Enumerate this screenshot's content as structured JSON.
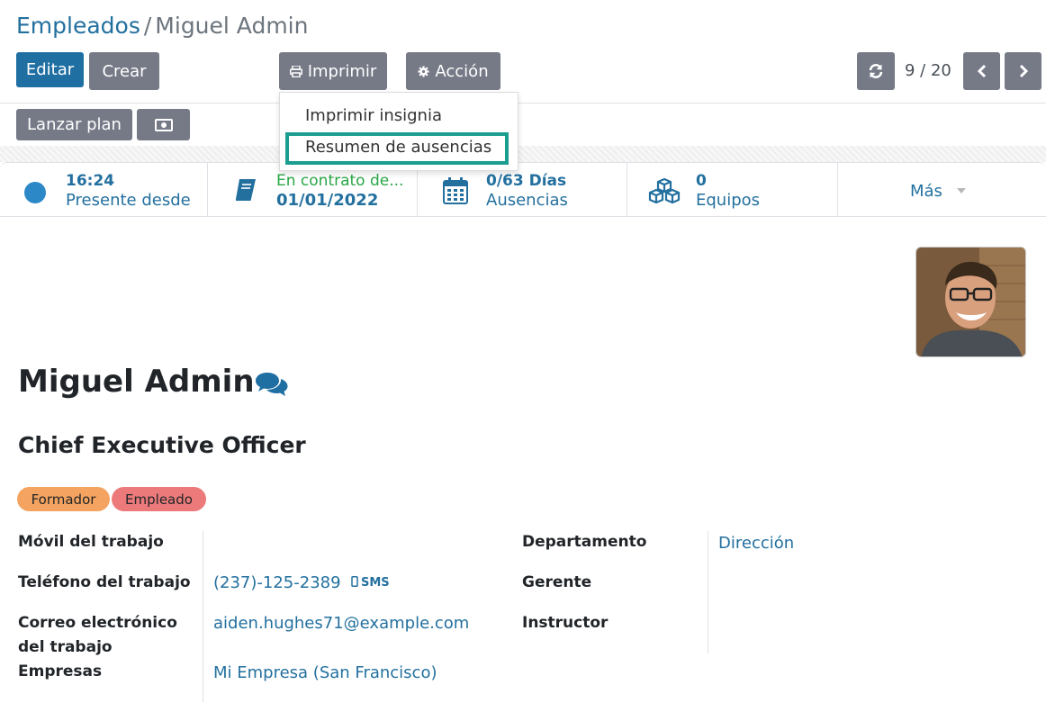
{
  "breadcrumb": {
    "parent": "Empleados",
    "separator": "/",
    "current": "Miguel Admin"
  },
  "toolbar": {
    "edit_label": "Editar",
    "create_label": "Crear",
    "print_label": "Imprimir",
    "action_label": "Acción",
    "launch_plan_label": "Lanzar plan"
  },
  "pager": {
    "value": "9 / 20"
  },
  "print_menu": {
    "items": [
      "Imprimir insignia",
      "Resumen de ausencias"
    ],
    "highlighted_item": "Resumen de ausencias"
  },
  "stats": {
    "presence": {
      "value": "16:24",
      "label": "Presente desde",
      "status_color": "#2d88c8"
    },
    "contract": {
      "label": "En contrato de...",
      "value": "01/01/2022"
    },
    "absences": {
      "value": "0/63 Días",
      "label": "Ausencias"
    },
    "teams": {
      "value": "0",
      "label": "Equipos"
    },
    "more_label": "Más"
  },
  "employee": {
    "name": "Miguel Admin",
    "job_title": "Chief Executive Officer",
    "tags": [
      {
        "label": "Formador",
        "color": "#f4a460"
      },
      {
        "label": "Empleado",
        "color": "#ec7a7a"
      }
    ]
  },
  "fields": {
    "mobile_label": "Móvil del trabajo",
    "phone_label": "Teléfono del trabajo",
    "phone_value": "(237)-125-2389",
    "sms_label": "SMS",
    "email_label_line1": "Correo electrónico",
    "email_label_line2": "del trabajo",
    "email_value": "aiden.hughes71@example.com",
    "company_label": "Empresas",
    "company_value": "Mi Empresa (San Francisco)",
    "department_label": "Departamento",
    "department_value": "Dirección",
    "manager_label": "Gerente",
    "coach_label": "Instructor"
  },
  "colors": {
    "primary": "#1f6fa3",
    "secondary": "#767a87",
    "link": "#23709f",
    "highlight_border": "#1b9e91"
  }
}
